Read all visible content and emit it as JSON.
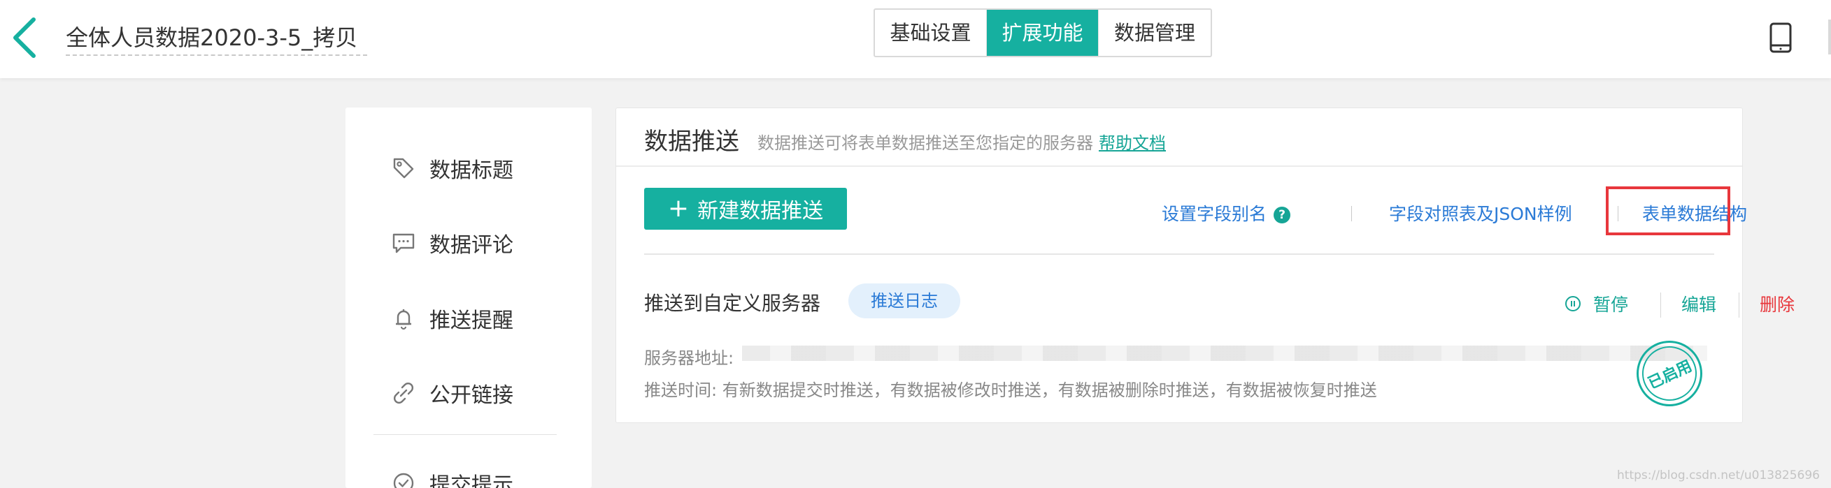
{
  "header": {
    "form_title": "全体人员数据2020-3-5_拷贝",
    "tabs": [
      {
        "label": "基础设置",
        "active": false
      },
      {
        "label": "扩展功能",
        "active": true
      },
      {
        "label": "数据管理",
        "active": false
      }
    ]
  },
  "sidebar": {
    "items": [
      {
        "label": "数据标题",
        "icon": "tag-icon"
      },
      {
        "label": "数据评论",
        "icon": "comment-icon"
      },
      {
        "label": "推送提醒",
        "icon": "bell-icon"
      },
      {
        "label": "公开链接",
        "icon": "link-icon"
      },
      {
        "label": "提交提示",
        "icon": "check-circle-icon"
      }
    ]
  },
  "panel": {
    "title": "数据推送",
    "description": "数据推送可将表单数据推送至您指定的服务器",
    "help_link": "帮助文档",
    "new_button": "新建数据推送",
    "toolbar_links": {
      "field_alias": "设置字段别名",
      "field_mapping": "字段对照表及JSON样例",
      "form_structure": "表单数据结构"
    },
    "push_item": {
      "title": "推送到自定义服务器",
      "log_badge": "推送日志",
      "actions": {
        "pause": "暂停",
        "edit": "编辑",
        "delete": "删除"
      },
      "server_address_label": "服务器地址:",
      "push_time_text": "推送时间: 有新数据提交时推送，有数据被修改时推送，有数据被删除时推送，有数据被恢复时推送",
      "status_stamp": "已启用"
    }
  },
  "colors": {
    "accent": "#16b0a0",
    "link": "#2a7ad6",
    "danger": "#e8373c",
    "highlight_border": "#e8373c"
  },
  "watermark": "https://blog.csdn.net/u013825696"
}
